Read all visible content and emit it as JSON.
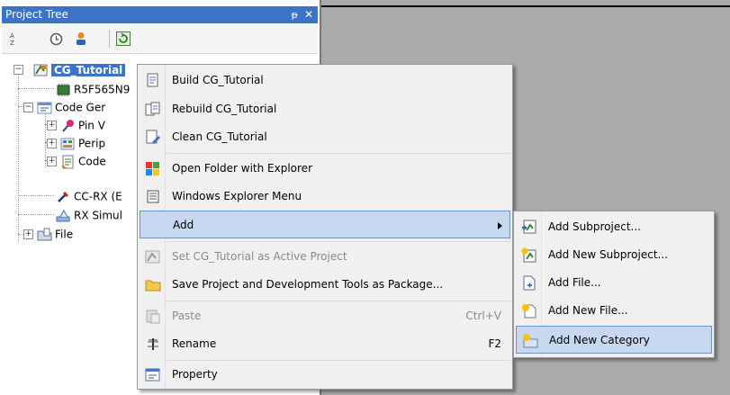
{
  "panel": {
    "title": "Project Tree",
    "pin_glyph": "ᵽ",
    "close_glyph": "✕",
    "toolbar": [
      {
        "name": "sort-az-icon"
      },
      {
        "name": "clock-icon"
      },
      {
        "name": "person-icon"
      },
      {
        "name": "refresh-icon"
      }
    ]
  },
  "tree": {
    "root": "CG_Tutorial",
    "items": [
      {
        "label": "R5F565N9",
        "icon": "chip-icon"
      },
      {
        "label": "Code Ger",
        "icon": "code-generator-icon"
      },
      {
        "label": "Pin V",
        "icon": "pin-icon"
      },
      {
        "label": "Perip",
        "icon": "peripheral-icon"
      },
      {
        "label": "Code",
        "icon": "code-icon"
      },
      {
        "label": "CC-RX (E",
        "icon": "compiler-icon"
      },
      {
        "label": "RX Simul",
        "icon": "simulator-icon"
      },
      {
        "label": "File",
        "icon": "folder-icon"
      }
    ]
  },
  "context_menu": {
    "items": [
      {
        "label": "Build CG_Tutorial",
        "icon": "build-icon",
        "shortcut": "",
        "disabled": false
      },
      {
        "label": "Rebuild CG_Tutorial",
        "icon": "rebuild-icon",
        "shortcut": "",
        "disabled": false
      },
      {
        "label": "Clean CG_Tutorial",
        "icon": "clean-icon",
        "shortcut": "",
        "disabled": false
      },
      {
        "label": "Open Folder with Explorer",
        "icon": "open-folder-icon",
        "shortcut": "",
        "disabled": false
      },
      {
        "label": "Windows Explorer Menu",
        "icon": "explorer-menu-icon",
        "shortcut": "",
        "disabled": false
      },
      {
        "label": "Add",
        "icon": "",
        "shortcut": "",
        "disabled": false,
        "submenu": true,
        "highlighted": true
      },
      {
        "label": "Set CG_Tutorial as Active Project",
        "icon": "active-project-icon",
        "shortcut": "",
        "disabled": true
      },
      {
        "label": "Save Project and Development Tools as Package...",
        "icon": "package-icon",
        "shortcut": "",
        "disabled": false
      },
      {
        "label": "Paste",
        "icon": "paste-icon",
        "shortcut": "Ctrl+V",
        "disabled": true
      },
      {
        "label": "Rename",
        "icon": "rename-icon",
        "shortcut": "F2",
        "disabled": false
      },
      {
        "label": "Property",
        "icon": "property-icon",
        "shortcut": "",
        "disabled": false
      }
    ]
  },
  "submenu": {
    "items": [
      {
        "label": "Add Subproject...",
        "icon": "add-subproject-icon"
      },
      {
        "label": "Add New Subproject...",
        "icon": "add-new-subproject-icon"
      },
      {
        "label": "Add File...",
        "icon": "add-file-icon"
      },
      {
        "label": "Add New File...",
        "icon": "add-new-file-icon"
      },
      {
        "label": "Add New Category",
        "icon": "add-category-icon",
        "highlighted": true
      }
    ]
  },
  "colors": {
    "title_bar": "#3b73c8",
    "workspace": "#aaaaaa",
    "menu_highlight": "#c7d9f0"
  }
}
